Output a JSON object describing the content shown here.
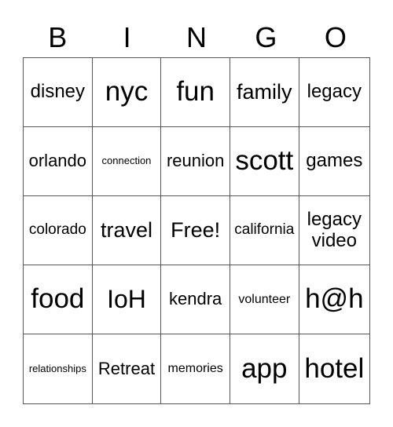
{
  "header": [
    "B",
    "I",
    "N",
    "G",
    "O"
  ],
  "cells": [
    "disney",
    "nyc",
    "fun",
    "family",
    "legacy",
    "orlando",
    "connection",
    "reunion",
    "scott",
    "games",
    "colorado",
    "travel",
    "Free!",
    "california",
    "legacy video",
    "food",
    "IoH",
    "kendra",
    "volunteer",
    "h@h",
    "relationships",
    "Retreat",
    "memories",
    "app",
    "hotel"
  ]
}
